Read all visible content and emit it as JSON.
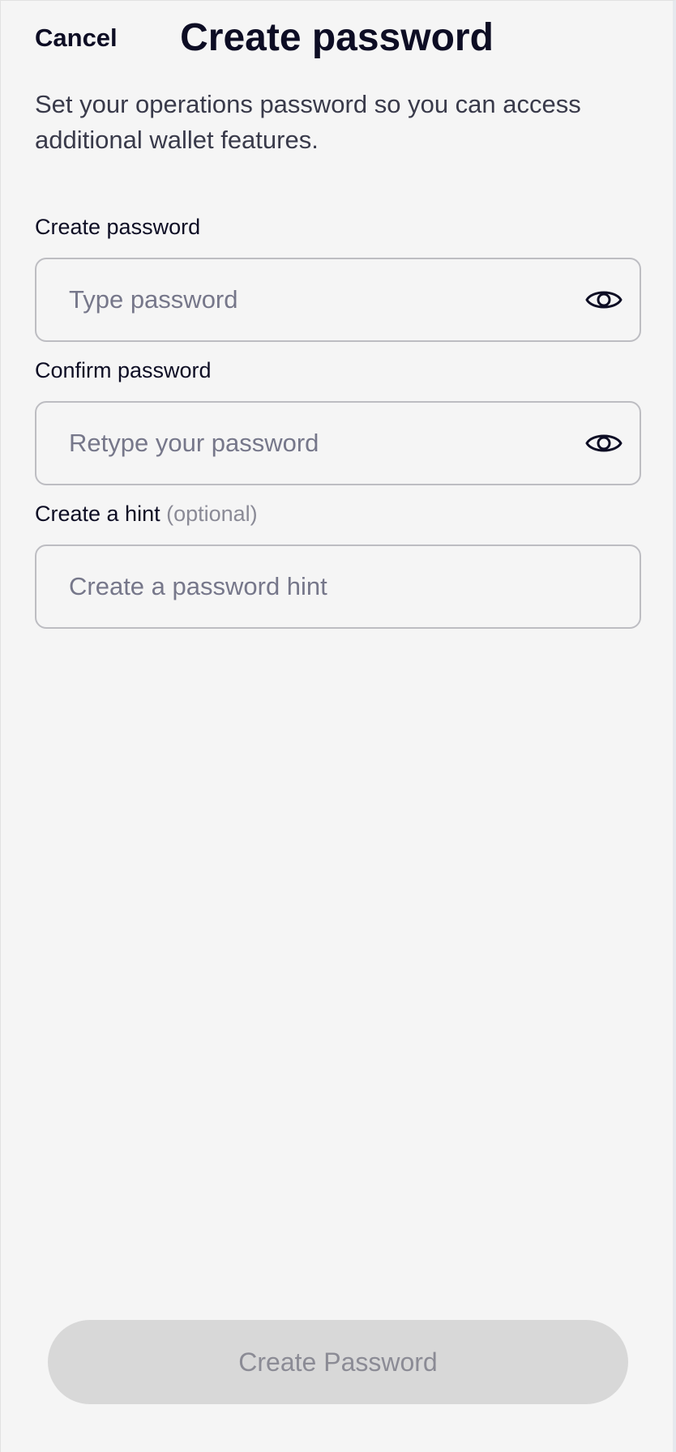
{
  "header": {
    "cancel_label": "Cancel",
    "title": "Create password"
  },
  "subtitle": "Set your operations password so you can access additional wallet features.",
  "fields": {
    "password": {
      "label": "Create password",
      "placeholder": "Type password",
      "value": "",
      "icon": "eye-icon"
    },
    "confirm": {
      "label": "Confirm password",
      "placeholder": "Retype your password",
      "value": "",
      "icon": "eye-icon"
    },
    "hint": {
      "label": "Create a hint",
      "optional_label": "(optional)",
      "placeholder": "Create a password hint",
      "value": ""
    }
  },
  "primary_button": {
    "label": "Create Password",
    "state": "disabled"
  },
  "colors": {
    "background": "#f5f5f5",
    "text": "#0d0d24",
    "placeholder": "#76778a",
    "button_disabled_bg": "#d8d8d8",
    "button_disabled_text": "#8b8b95"
  }
}
